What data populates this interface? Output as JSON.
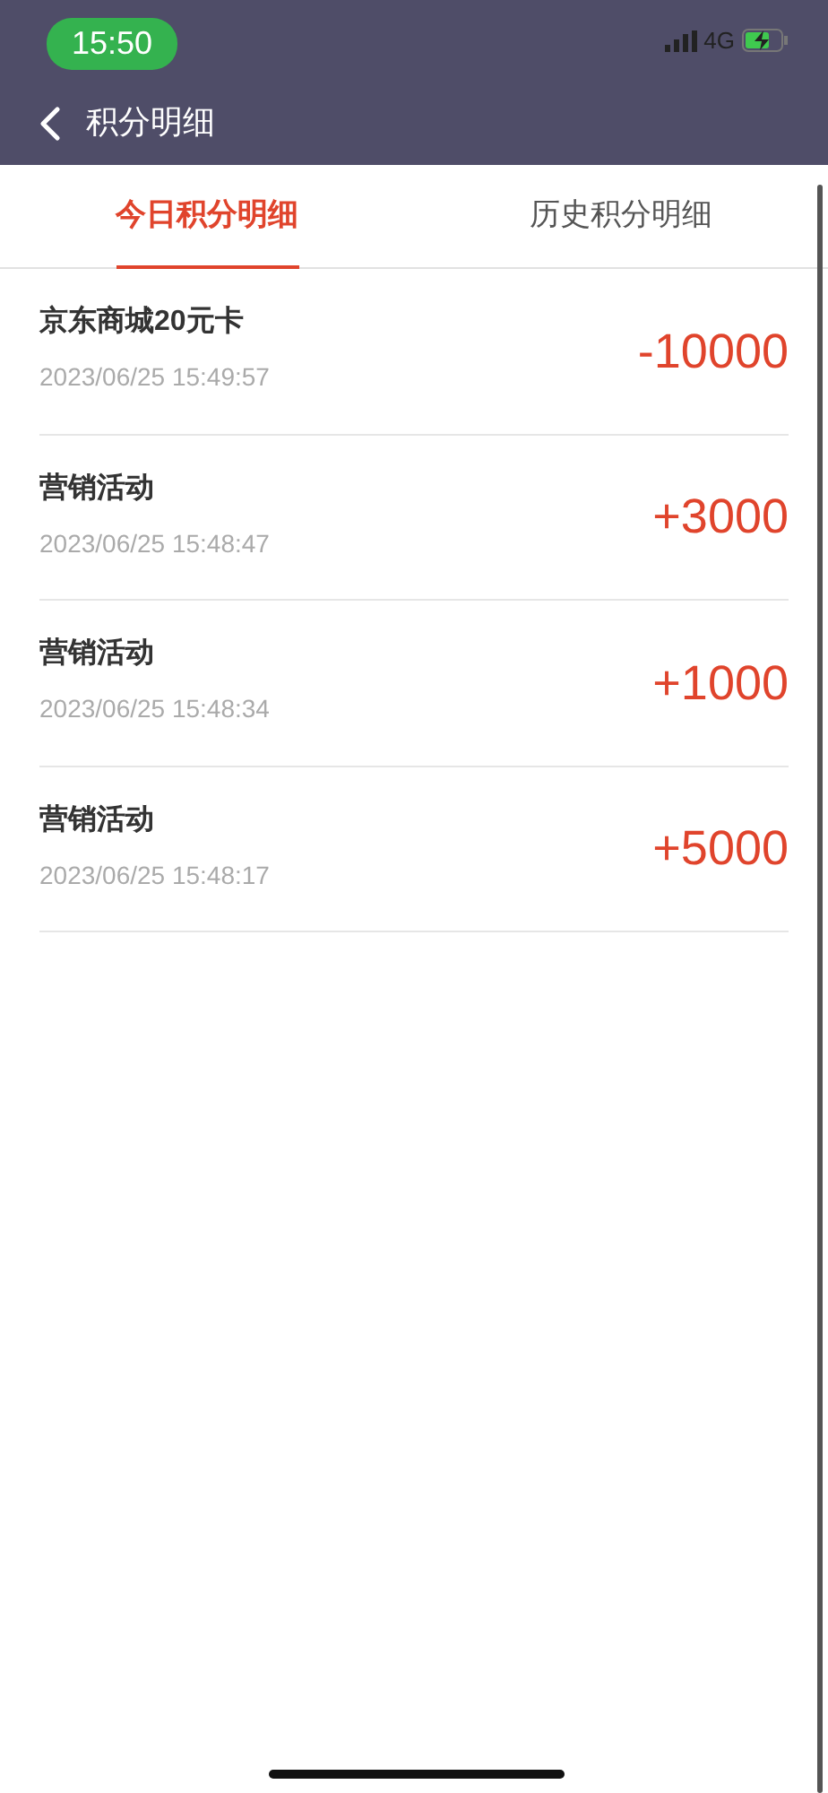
{
  "status_bar": {
    "time": "15:50",
    "network": "4G"
  },
  "nav_bar": {
    "title": "积分明细"
  },
  "tabs": [
    {
      "label": "今日积分明细",
      "selected": true
    },
    {
      "label": "历史积分明细",
      "selected": false
    }
  ],
  "records": [
    {
      "title": "京东商城20元卡",
      "time": "2023/06/25 15:49:57",
      "amount": "-10000"
    },
    {
      "title": "营销活动",
      "time": "2023/06/25 15:48:47",
      "amount": "+3000"
    },
    {
      "title": "营销活动",
      "time": "2023/06/25 15:48:34",
      "amount": "+1000"
    },
    {
      "title": "营销活动",
      "time": "2023/06/25 15:48:17",
      "amount": "+5000"
    }
  ]
}
